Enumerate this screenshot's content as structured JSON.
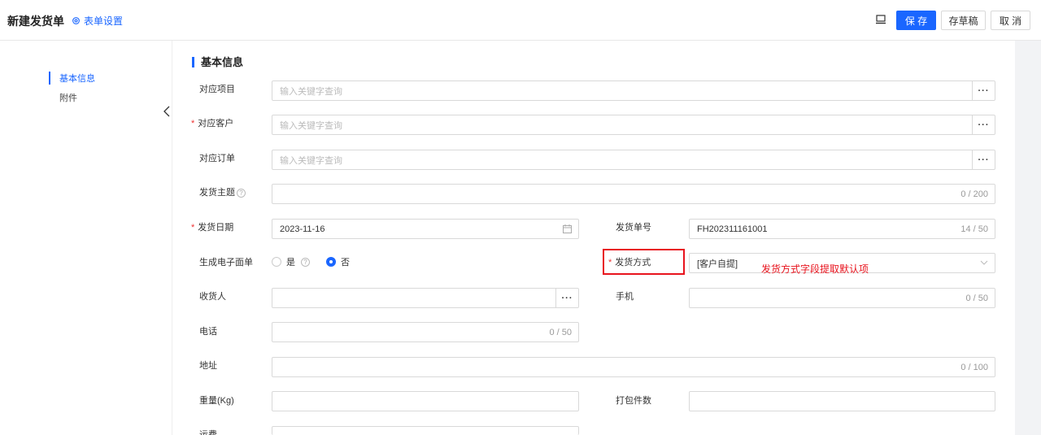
{
  "header": {
    "title": "新建发货单",
    "form_settings": "表单设置",
    "save_label": "保 存",
    "draft_label": "存草稿",
    "cancel_label": "取 消"
  },
  "sidebar": {
    "items": [
      {
        "label": "基本信息",
        "active": true
      },
      {
        "label": "附件",
        "active": false
      }
    ]
  },
  "section": {
    "title": "基本信息"
  },
  "form": {
    "project": {
      "label": "对应项目",
      "placeholder": "输入关键字查询"
    },
    "customer": {
      "label": "对应客户",
      "placeholder": "输入关键字查询",
      "required": true
    },
    "order": {
      "label": "对应订单",
      "placeholder": "输入关键字查询"
    },
    "subject": {
      "label": "发货主题",
      "counter": "0 / 200"
    },
    "ship_date": {
      "label": "发货日期",
      "value": "2023-11-16",
      "required": true
    },
    "ship_no": {
      "label": "发货单号",
      "value": "FH202311161001",
      "counter": "14 / 50"
    },
    "e_waybill": {
      "label": "生成电子面单",
      "options": [
        "是",
        "否"
      ],
      "selected": "否"
    },
    "ship_method": {
      "label": "发货方式",
      "value": "[客户自提]",
      "required": true
    },
    "receiver": {
      "label": "收货人"
    },
    "mobile": {
      "label": "手机",
      "counter": "0 / 50"
    },
    "phone": {
      "label": "电话",
      "counter": "0 / 50"
    },
    "address": {
      "label": "地址",
      "counter": "0 / 100"
    },
    "weight": {
      "label": "重量(Kg)"
    },
    "packages": {
      "label": "打包件数"
    },
    "freight": {
      "label": "运费"
    }
  },
  "annotation": "发货方式字段提取默认项",
  "colors": {
    "accent": "#1a66ff",
    "annotation": "#e8131d",
    "required": "#ee3333"
  }
}
